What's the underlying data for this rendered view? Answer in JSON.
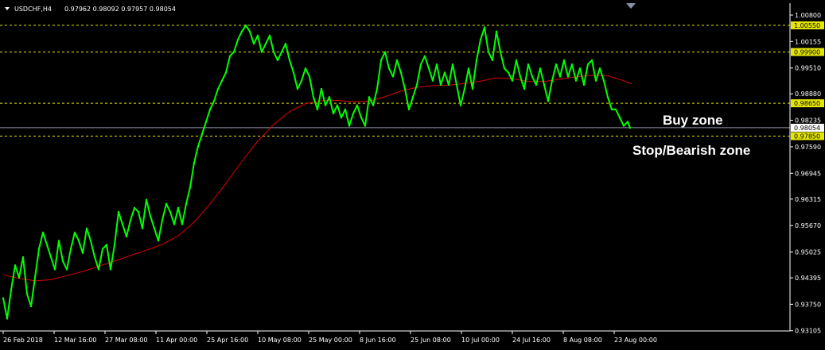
{
  "header": {
    "symbol": "USDCHF,H4",
    "ohlc": "0.97962 0.98092 0.97957 0.98054"
  },
  "annotations": {
    "buy_zone": "Buy zone",
    "stop_zone": "Stop/Bearish zone"
  },
  "colors": {
    "background": "#000000",
    "price": "#00ff00",
    "moving_average": "#e00000",
    "horizontal_levels": "#e6e600",
    "current_price_line": "#8c95a8",
    "axis": "#ffffff"
  },
  "chart_data": {
    "type": "line",
    "title": "USDCHF,H4",
    "grid": false,
    "x_tick_labels": [
      "26 Feb 2018",
      "12 Mar 16:00",
      "27 Mar 08:00",
      "11 Apr 00:00",
      "25 Apr 16:00",
      "10 May 08:00",
      "25 May 00:00",
      "8 Jun 16:00",
      "25 Jun 08:00",
      "10 Jul 00:00",
      "24 Jul 16:00",
      "8 Aug 08:00",
      "23 Aug 00:00"
    ],
    "y_tick_labels": [
      "1.00800",
      "1.00155",
      "0.99510",
      "0.98880",
      "0.98235",
      "0.97590",
      "0.96945",
      "0.96315",
      "0.95670",
      "0.95025",
      "0.94395",
      "0.93750",
      "0.93105"
    ],
    "ylim": [
      0.931,
      1.008
    ],
    "horizontal_levels": [
      1.0055,
      0.999,
      0.9865,
      0.9785
    ],
    "horizontal_level_labels": [
      "1.00550",
      "0.99900",
      "0.98650",
      "0.97850"
    ],
    "current_price": 0.98054,
    "current_price_label": "0.98054",
    "series": [
      {
        "id": "price",
        "x": [
          0,
          5,
          10,
          15,
          20,
          25,
          30,
          35,
          40,
          45,
          50,
          55,
          60,
          65,
          70,
          75,
          80,
          85,
          90,
          95,
          100,
          105,
          110,
          115,
          120,
          125,
          130,
          135,
          140,
          145,
          150,
          155,
          160,
          165,
          170,
          175,
          180,
          185,
          190,
          195,
          200,
          205,
          210,
          215,
          220,
          225,
          230,
          235,
          240,
          245,
          250,
          255,
          260,
          265,
          270,
          275,
          280,
          285,
          290,
          295,
          300,
          305,
          310,
          315,
          320,
          325,
          330,
          335,
          340,
          345,
          350,
          355,
          360,
          365,
          370,
          375,
          380,
          385,
          390,
          395,
          400,
          405,
          410,
          415,
          420,
          425,
          430,
          435,
          440,
          445,
          450,
          455,
          460,
          465,
          470,
          475,
          480,
          485,
          490,
          495,
          500,
          505,
          510,
          515,
          520,
          525,
          530,
          535,
          540,
          545,
          550,
          555,
          560,
          565,
          570,
          575,
          580,
          585,
          590,
          595,
          600,
          605,
          610,
          615,
          620,
          625,
          630,
          635,
          640,
          645,
          650,
          655,
          660,
          665,
          670,
          675,
          680,
          685,
          690,
          695,
          700,
          705,
          710,
          715,
          720,
          725,
          730,
          735,
          740,
          745,
          750,
          755,
          760,
          765,
          770,
          775,
          780,
          785,
          788
        ],
        "values": [
          0.939,
          0.934,
          0.941,
          0.947,
          0.944,
          0.949,
          0.94,
          0.937,
          0.944,
          0.951,
          0.955,
          0.952,
          0.949,
          0.946,
          0.953,
          0.948,
          0.946,
          0.951,
          0.955,
          0.953,
          0.95,
          0.956,
          0.953,
          0.949,
          0.946,
          0.951,
          0.952,
          0.946,
          0.952,
          0.96,
          0.957,
          0.954,
          0.958,
          0.961,
          0.96,
          0.956,
          0.963,
          0.959,
          0.956,
          0.953,
          0.958,
          0.962,
          0.96,
          0.957,
          0.961,
          0.957,
          0.962,
          0.966,
          0.972,
          0.976,
          0.979,
          0.982,
          0.985,
          0.987,
          0.99,
          0.992,
          0.994,
          0.998,
          0.999,
          1.002,
          1.004,
          1.0055,
          1.004,
          1.001,
          1.003,
          0.999,
          1.001,
          1.003,
          0.999,
          0.997,
          0.999,
          1.001,
          0.997,
          0.994,
          0.99,
          0.992,
          0.995,
          0.993,
          0.988,
          0.985,
          0.99,
          0.986,
          0.988,
          0.984,
          0.986,
          0.983,
          0.985,
          0.981,
          0.984,
          0.986,
          0.983,
          0.981,
          0.988,
          0.986,
          0.99,
          0.997,
          0.999,
          0.995,
          0.993,
          0.997,
          0.994,
          0.99,
          0.985,
          0.988,
          0.991,
          0.996,
          0.998,
          0.995,
          0.992,
          0.996,
          0.991,
          0.994,
          0.991,
          0.996,
          0.991,
          0.986,
          0.99,
          0.995,
          0.99,
          0.997,
          1.002,
          1.005,
          0.999,
          0.997,
          1.004,
          0.999,
          0.995,
          0.994,
          0.992,
          0.997,
          0.993,
          0.99,
          0.996,
          0.993,
          0.991,
          0.995,
          0.991,
          0.987,
          0.992,
          0.996,
          0.993,
          0.997,
          0.993,
          0.996,
          0.992,
          0.995,
          0.991,
          0.996,
          0.997,
          0.992,
          0.995,
          0.992,
          0.988,
          0.985,
          0.985,
          0.983,
          0.981,
          0.982,
          0.9805
        ]
      },
      {
        "id": "moving_average",
        "x": [
          0,
          20,
          40,
          60,
          80,
          100,
          120,
          140,
          160,
          180,
          200,
          220,
          240,
          260,
          280,
          300,
          320,
          340,
          360,
          380,
          400,
          420,
          440,
          460,
          480,
          500,
          520,
          540,
          560,
          580,
          600,
          620,
          640,
          660,
          680,
          700,
          720,
          740,
          760,
          780,
          790
        ],
        "values": [
          0.9447,
          0.9438,
          0.9432,
          0.9435,
          0.9445,
          0.9455,
          0.9468,
          0.948,
          0.9494,
          0.9507,
          0.9521,
          0.9542,
          0.9575,
          0.962,
          0.967,
          0.9723,
          0.9773,
          0.9813,
          0.9845,
          0.9864,
          0.9871,
          0.9872,
          0.9869,
          0.987,
          0.9881,
          0.9895,
          0.9904,
          0.9908,
          0.9909,
          0.9913,
          0.9919,
          0.9927,
          0.9925,
          0.9918,
          0.9918,
          0.9924,
          0.9929,
          0.9933,
          0.9932,
          0.992,
          0.9912
        ]
      }
    ]
  }
}
